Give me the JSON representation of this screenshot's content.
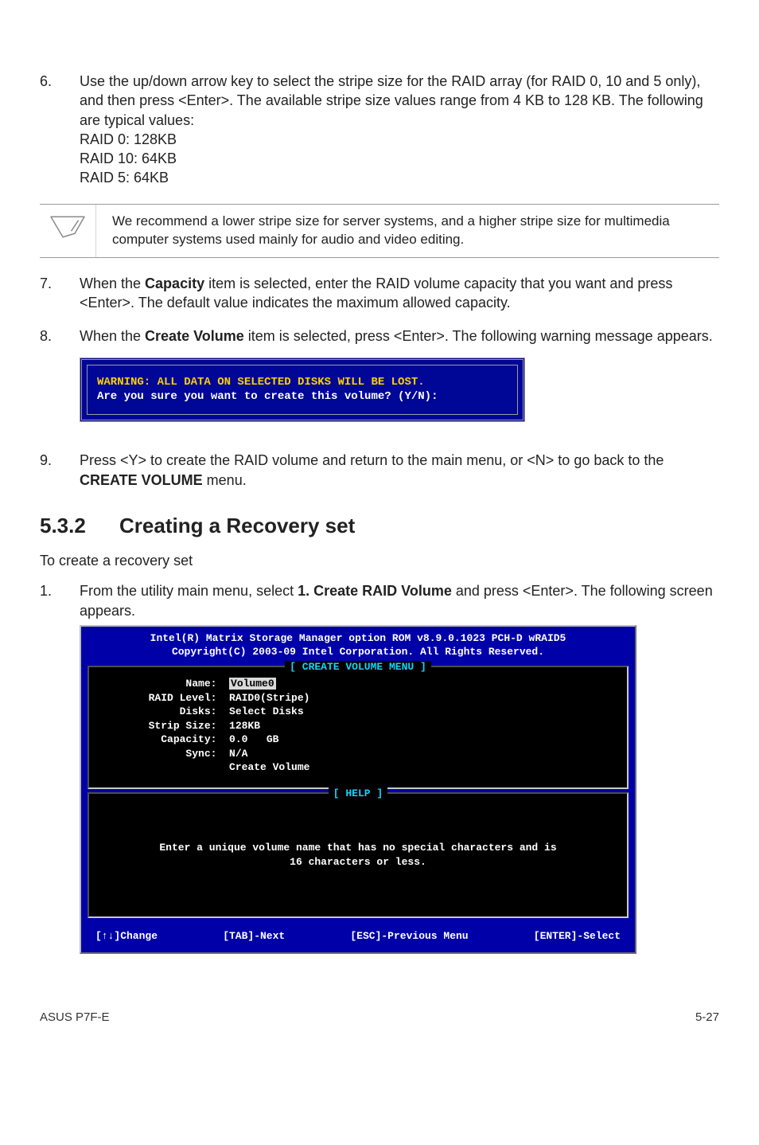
{
  "step6": {
    "num": "6.",
    "para": "Use the up/down arrow key to select the stripe size for the RAID array (for RAID 0, 10 and 5 only), and then press <Enter>. The available stripe size values range from 4 KB to 128 KB. The following are typical values:",
    "l1": "RAID 0: 128KB",
    "l2": "RAID 10: 64KB",
    "l3": "RAID 5: 64KB"
  },
  "note": "We recommend a lower stripe size for server systems, and a higher stripe size for multimedia computer systems used mainly for audio and video editing.",
  "step7": {
    "num": "7.",
    "pre": "When the ",
    "bold": "Capacity",
    "post": " item is selected, enter the RAID volume capacity that you want and press <Enter>. The default value indicates the maximum allowed capacity."
  },
  "step8": {
    "num": "8.",
    "pre": "When the ",
    "bold": "Create Volume",
    "post": " item is selected, press <Enter>. The following warning message appears."
  },
  "dialog": {
    "warn": "WARNING: ALL DATA ON SELECTED DISKS WILL BE LOST.",
    "prompt": "Are you sure you want to create this volume? (Y/N):"
  },
  "step9": {
    "num": "9.",
    "pre": "Press <Y> to create the RAID volume and return to the main menu, or <N> to go back to the ",
    "bold": "CREATE VOLUME",
    "post": " menu."
  },
  "section": {
    "num": "5.3.2",
    "title": "Creating a Recovery set"
  },
  "intro": "To create a recovery set",
  "step1": {
    "num": "1.",
    "pre": "From the utility main menu, select ",
    "bold": "1. Create RAID Volume",
    "post": " and press <Enter>. The following screen appears."
  },
  "bios": {
    "hdr1": "Intel(R) Matrix Storage Manager option ROM v8.9.0.1023 PCH-D wRAID5",
    "hdr2": "Copyright(C) 2003-09 Intel Corporation.  All Rights Reserved.",
    "panel1_title": "[ CREATE VOLUME MENU ]",
    "rows": {
      "r1_label": "             Name:  ",
      "r1_val": "Volume0",
      "r2": "       RAID Level:  RAID0(Stripe)",
      "r3": "            Disks:  Select Disks",
      "r4": "       Strip Size:  128KB",
      "r5": "         Capacity:  0.0   GB",
      "r6": "             Sync:  N/A",
      "r7": "                    Create Volume"
    },
    "panel2_title": "[ HELP ]",
    "help1": "Enter a unique volume name that has no special characters and is",
    "help2": "16 characters or less.",
    "foot_change": "[↑↓]Change",
    "foot_tab": "[TAB]-Next",
    "foot_esc": "[ESC]-Previous Menu",
    "foot_enter": "[ENTER]-Select"
  },
  "footer": {
    "left": "ASUS P7F-E",
    "right": "5-27"
  }
}
